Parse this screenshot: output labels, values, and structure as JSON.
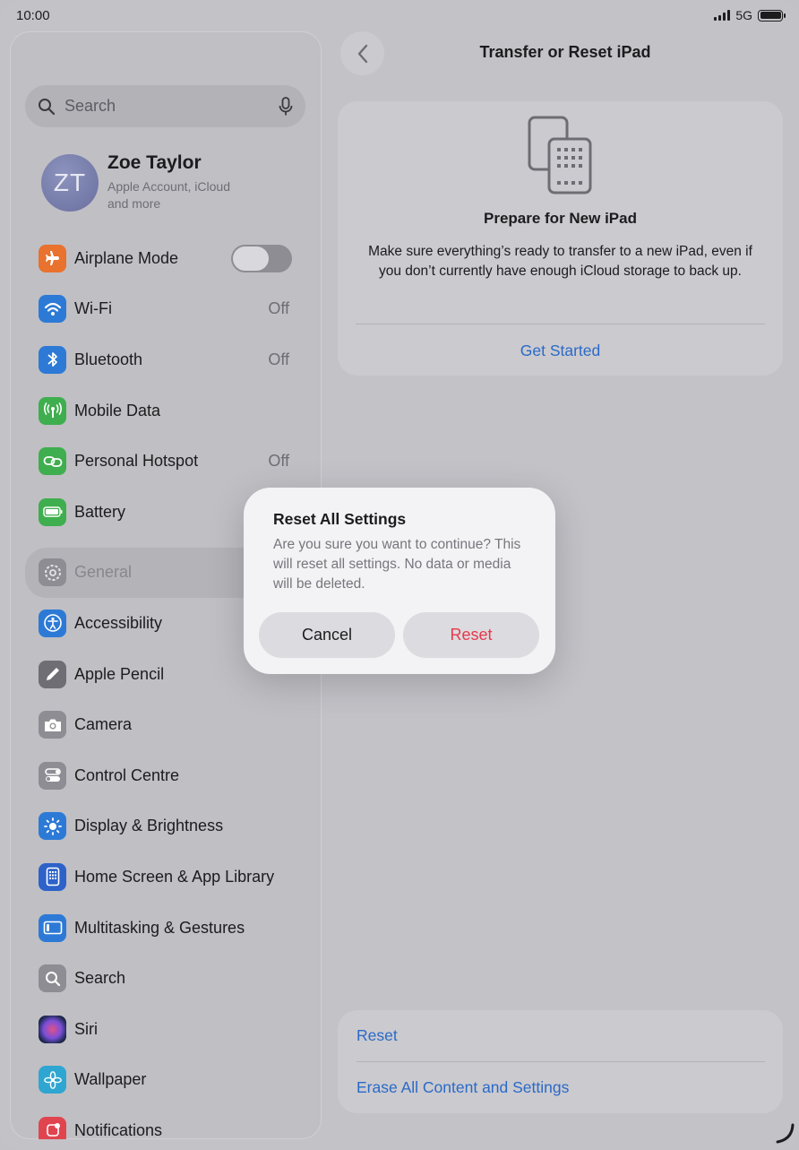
{
  "status_bar": {
    "time": "10:00",
    "network": "5G"
  },
  "sidebar": {
    "search_placeholder": "Search",
    "profile": {
      "initials": "ZT",
      "name": "Zoe Taylor",
      "subtitle": "Apple Account, iCloud and more"
    },
    "items": [
      {
        "label": "Airplane Mode",
        "icon": "airplane-icon",
        "color": "#e8722e",
        "toggle": false
      },
      {
        "label": "Wi-Fi",
        "icon": "wifi-icon",
        "color": "#2d7ad6",
        "value": "Off"
      },
      {
        "label": "Bluetooth",
        "icon": "bluetooth-icon",
        "color": "#2d7ad6",
        "value": "Off"
      },
      {
        "label": "Mobile Data",
        "icon": "antenna-icon",
        "color": "#3fae4e"
      },
      {
        "label": "Personal Hotspot",
        "icon": "link-icon",
        "color": "#3fae4e",
        "value": "Off"
      },
      {
        "label": "Battery",
        "icon": "battery-icon",
        "color": "#3fae4e"
      },
      {
        "label": "General",
        "icon": "gear-icon",
        "color": "#8e8d93",
        "selected": true
      },
      {
        "label": "Accessibility",
        "icon": "accessibility-icon",
        "color": "#2d7ad6"
      },
      {
        "label": "Apple Pencil",
        "icon": "pencil-icon",
        "color": "#6f6e74"
      },
      {
        "label": "Camera",
        "icon": "camera-icon",
        "color": "#8e8d93"
      },
      {
        "label": "Control Centre",
        "icon": "switches-icon",
        "color": "#8e8d93"
      },
      {
        "label": "Display & Brightness",
        "icon": "sun-icon",
        "color": "#2d7ad6"
      },
      {
        "label": "Home Screen & App Library",
        "icon": "grid-icon",
        "color": "#2d62c9"
      },
      {
        "label": "Multitasking & Gestures",
        "icon": "multitask-icon",
        "color": "#2d7ad6"
      },
      {
        "label": "Search",
        "icon": "search-icon",
        "color": "#8e8d93"
      },
      {
        "label": "Siri",
        "icon": "siri-icon",
        "color": "#2a2a4a"
      },
      {
        "label": "Wallpaper",
        "icon": "flower-icon",
        "color": "#2fa6d1"
      },
      {
        "label": "Notifications",
        "icon": "bell-icon",
        "color": "#e0454f"
      }
    ]
  },
  "detail": {
    "title": "Transfer or Reset iPad",
    "prepare": {
      "title": "Prepare for New iPad",
      "description": "Make sure everything’s ready to transfer to a new iPad, even if you don’t currently have enough iCloud storage to back up.",
      "action": "Get Started"
    },
    "reset_options": [
      "Reset",
      "Erase All Content and Settings"
    ]
  },
  "alert": {
    "title": "Reset All Settings",
    "message": "Are you sure you want to continue? This will reset all settings. No data or media will be deleted.",
    "cancel_label": "Cancel",
    "confirm_label": "Reset"
  }
}
